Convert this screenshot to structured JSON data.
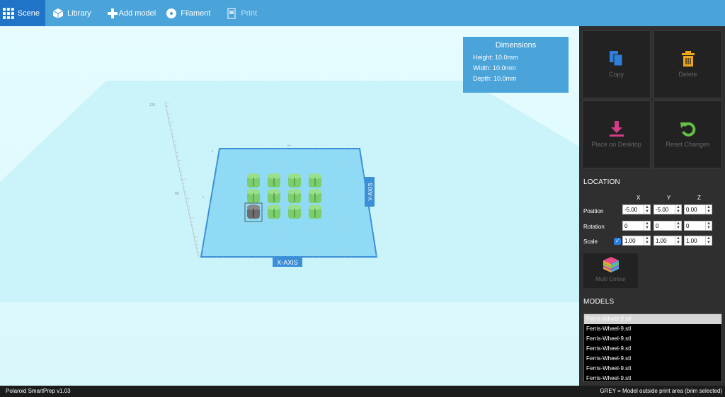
{
  "nav": {
    "scene": "Scene",
    "library": "Library",
    "add_model": "Add model",
    "filament": "Filament",
    "print": "Print"
  },
  "dimensions": {
    "title": "Dimensions",
    "height": "Height: 10.0mm",
    "width": "Width: 10.0mm",
    "depth": "Depth: 10.0mm"
  },
  "axes": {
    "x_label": "X-AXIS",
    "y_label": "Y-AXIS",
    "ruler_top": "120",
    "ruler_mid": "60",
    "plate_top_left": "0",
    "plate_top_mid": "60",
    "plate_mid_left": "0"
  },
  "actions": {
    "copy": "Copy",
    "delete": "Delete",
    "place_on_desktop": "Place on Desktop",
    "reset_changes": "Reset Changes"
  },
  "location": {
    "title": "LOCATION",
    "x": "X",
    "y": "Y",
    "z": "Z",
    "position_label": "Position",
    "rotation_label": "Rotation",
    "scale_label": "Scale",
    "position": [
      "-5.00",
      "-5.00",
      "0.00"
    ],
    "rotation": [
      "0",
      "0",
      "0"
    ],
    "scale": [
      "1.00",
      "1.00",
      "1.00"
    ],
    "scale_locked": true
  },
  "multi_colour": "Multi Colour",
  "models": {
    "title": "MODELS",
    "items": [
      "Ferris-Wheel-9.stl",
      "Ferris-Wheel-9.stl",
      "Ferris-Wheel-9.stl",
      "Ferris-Wheel-9.stl",
      "Ferris-Wheel-9.stl",
      "Ferris-Wheel-9.stl",
      "Ferris-Wheel-9.stl"
    ],
    "selected_index": 0
  },
  "footer": {
    "version": "Polaroid SmartPrep v1.03",
    "legend": "GREY = Model outside print area (brim selected)"
  },
  "colors": {
    "nav_bg": "#4aa3d9",
    "nav_active": "#1f74c7",
    "copy_icon": "#2f7fd6",
    "delete_icon": "#f0a51b",
    "place_icon": "#d23d86",
    "reset_icon": "#63c043",
    "model_green": "#7ccd6c",
    "model_grey": "#6d6d6d"
  }
}
